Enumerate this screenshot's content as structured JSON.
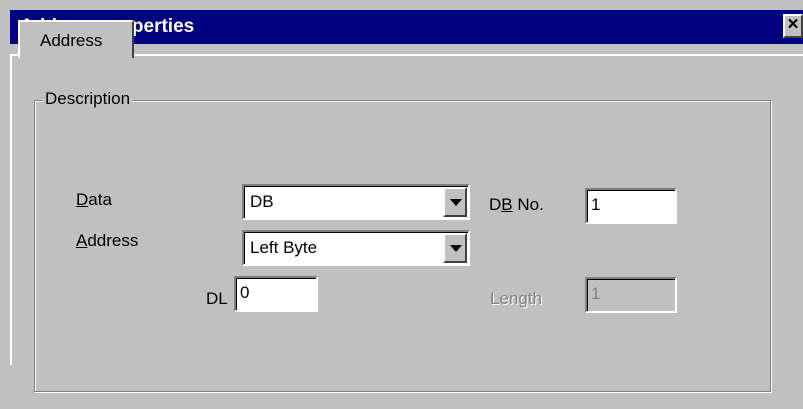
{
  "window": {
    "title": "Address properties",
    "close_glyph": "×"
  },
  "tabs": [
    {
      "label": "Address"
    }
  ],
  "group": {
    "title": "Description"
  },
  "fields": {
    "data": {
      "label_key": "D",
      "label_rest": "ata",
      "value": "DB"
    },
    "address": {
      "label_key": "A",
      "label_rest": "ddress",
      "value": "Left Byte"
    },
    "db_no": {
      "label_pre": "D",
      "label_key": "B",
      "label_rest": " No.",
      "value": "1"
    },
    "dl": {
      "label": "DL",
      "value": "0"
    },
    "length": {
      "label": "Length",
      "value": "1",
      "disabled": true
    }
  },
  "colors": {
    "titlebar": "#000080",
    "face": "#c0c0c0"
  }
}
